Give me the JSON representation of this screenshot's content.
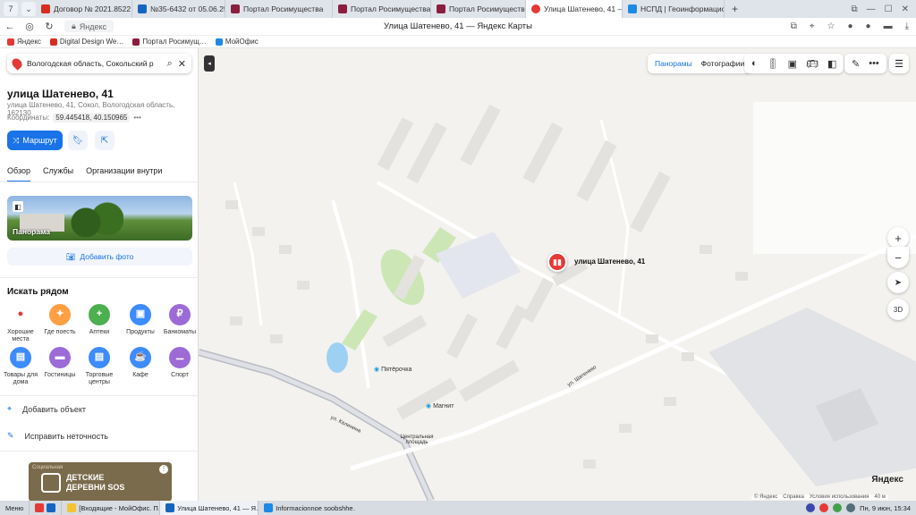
{
  "browser": {
    "tabs": [
      {
        "label": "Договор № 2021.8522",
        "active": false
      },
      {
        "label": "№35-6432 от 05.06.25",
        "active": false
      },
      {
        "label": "Портал Росимущества",
        "active": false
      },
      {
        "label": "Портал Росимущества",
        "active": false
      },
      {
        "label": "Портал Росимущества",
        "active": false
      },
      {
        "label": "Улица Шатенево, 41 —",
        "active": true
      },
      {
        "label": "НСПД | Геоинформацио…",
        "active": false
      }
    ],
    "tab_counter": "7",
    "domain": "Яндекс",
    "page_title": "Улица Шатенево, 41 — Яндекс Карты",
    "bookmarks": [
      "Яндекс",
      "Digital Design We…",
      "Портал Росимущ…",
      "МойОфис"
    ]
  },
  "sidebar": {
    "search_value": "Вологодская область, Сокольский р",
    "title": "улица Шатенево, 41",
    "address": "улица Шатенево, 41, Сокол, Вологодская область, 162130",
    "coords_label": "Координаты:",
    "coords_value": "59.445418, 40.150965",
    "route_label": "Маршрут",
    "tabs": [
      "Обзор",
      "Службы",
      "Организации внутри"
    ],
    "panorama_label": "Панорама",
    "add_photo": "Добавить фото",
    "nearby_title": "Искать рядом",
    "categories": [
      {
        "label": "Хорошие места",
        "color": "#ffffff",
        "glyph": "●"
      },
      {
        "label": "Где поесть",
        "color": "#ff9f43",
        "glyph": "✦"
      },
      {
        "label": "Аптеки",
        "color": "#4caf50",
        "glyph": "+"
      },
      {
        "label": "Продукты",
        "color": "#3d8bfd",
        "glyph": "▣"
      },
      {
        "label": "Банкоматы",
        "color": "#9c6bd6",
        "glyph": "₽"
      },
      {
        "label": "Товары для дома",
        "color": "#3d8bfd",
        "glyph": "▤"
      },
      {
        "label": "Гостиницы",
        "color": "#9c6bd6",
        "glyph": "▬"
      },
      {
        "label": "Торговые центры",
        "color": "#3d8bfd",
        "glyph": "▤"
      },
      {
        "label": "Кафе",
        "color": "#3d8bfd",
        "glyph": "☕"
      },
      {
        "label": "Спорт",
        "color": "#9c6bd6",
        "glyph": "⚊"
      }
    ],
    "add_object": "Добавить объект",
    "fix_error": "Исправить неточность",
    "ad": {
      "label": "Социальная",
      "text_line1": "ДЕТСКИЕ",
      "text_line2": "ДЕРЕВНИ SOS"
    }
  },
  "map": {
    "mode_panoramas": "Панорамы",
    "mode_photos": "Фотографии",
    "marker_label": "улица Шатенево, 41",
    "marker_number": "41",
    "zoom_in": "+",
    "zoom_out": "−",
    "btn_3d": "3D",
    "pois": [
      "Пятёрочка",
      "Магнит"
    ],
    "streets": [
      "ул. Калинина",
      "ул. Шатенево",
      "Центральная площадь"
    ],
    "logo": "Яндекс",
    "copyright": [
      "© Яндекс",
      "Справка",
      "Условия использования"
    ],
    "scale": "40 м"
  },
  "taskbar": {
    "start": "Меню",
    "items": [
      "[Входящие - МойОфис. П…",
      "Улица Шатенево, 41 — Я…",
      "Informacionnoe soobshhe…"
    ],
    "clock": "Пн, 9 июн, 15:34"
  },
  "colors": {
    "accent": "#1a73e8",
    "marker": "#e53935"
  }
}
